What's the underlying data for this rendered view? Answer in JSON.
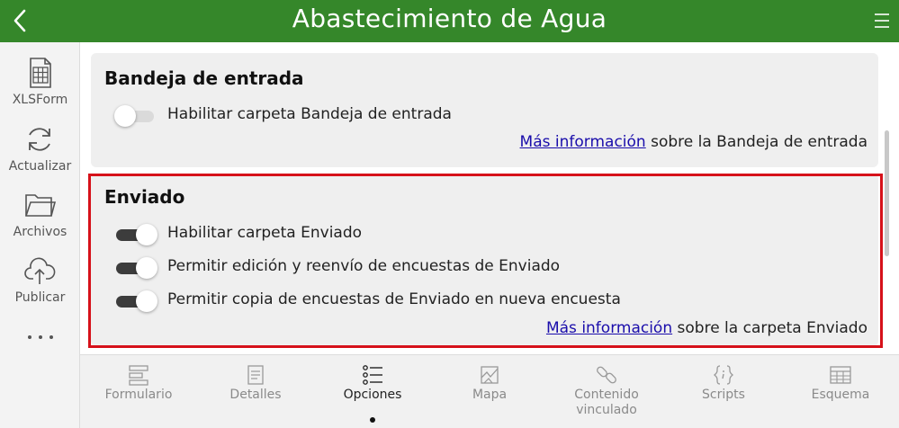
{
  "header": {
    "title": "Abastecimiento de Agua",
    "bar_color": "#35872a",
    "back_icon": "chevron-left-icon",
    "menu_icon": "hamburger-menu-icon"
  },
  "sidebar": {
    "items": [
      {
        "label": "XLSForm",
        "icon": "spreadsheet-icon"
      },
      {
        "label": "Actualizar",
        "icon": "refresh-icon"
      },
      {
        "label": "Archivos",
        "icon": "folder-icon"
      },
      {
        "label": "Publicar",
        "icon": "cloud-upload-icon"
      }
    ],
    "more_icon": "more-dots-icon"
  },
  "inbox": {
    "heading": "Bandeja de entrada",
    "toggles": [
      {
        "label": "Habilitar carpeta Bandeja de entrada",
        "on": false
      }
    ],
    "info_link": "Más información",
    "info_text": " sobre la Bandeja de entrada"
  },
  "sent": {
    "heading": "Enviado",
    "toggles": [
      {
        "label": "Habilitar carpeta Enviado",
        "on": true
      },
      {
        "label": "Permitir edición y reenvío de encuestas de Enviado",
        "on": true
      },
      {
        "label": "Permitir copia de encuestas de Enviado en nueva encuesta",
        "on": true
      }
    ],
    "info_link": "Más información",
    "info_text": " sobre la carpeta Enviado"
  },
  "tabs": [
    {
      "label": "Formulario",
      "icon": "form-icon",
      "active": false
    },
    {
      "label": "Detalles",
      "icon": "details-icon",
      "active": false
    },
    {
      "label": "Opciones",
      "icon": "options-list-icon",
      "active": true
    },
    {
      "label": "Mapa",
      "icon": "map-icon",
      "active": false
    },
    {
      "label": "Contenido vinculado",
      "icon": "link-icon",
      "active": false
    },
    {
      "label": "Scripts",
      "icon": "scripts-icon",
      "active": false
    },
    {
      "label": "Esquema",
      "icon": "table-icon",
      "active": false
    }
  ],
  "colors": {
    "highlight_border": "#d6111a",
    "link": "#1a0dab",
    "toggle_on": "#3c3c3c",
    "toggle_off": "#dadada"
  }
}
